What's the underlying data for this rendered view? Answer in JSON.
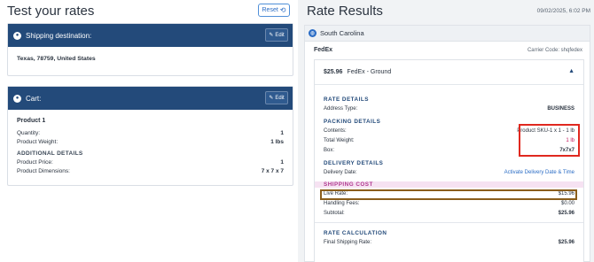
{
  "left": {
    "title": "Test your rates",
    "reset_label": "Reset",
    "shipping_card": {
      "title": "Shipping destination:",
      "edit_label": "Edit",
      "address": "Texas, 78759, United States"
    },
    "cart_card": {
      "title": "Cart:",
      "edit_label": "Edit",
      "product_name": "Product 1",
      "rows": [
        {
          "label": "Quantity:",
          "value": "1"
        },
        {
          "label": "Product Weight:",
          "value": "1 lbs"
        }
      ],
      "additional_heading": "ADDITIONAL DETAILS",
      "additional_rows": [
        {
          "label": "Product Price:",
          "value": "1"
        },
        {
          "label": "Product Dimensions:",
          "value": "7 x 7 x 7"
        }
      ]
    }
  },
  "right": {
    "title": "Rate Results",
    "timestamp": "09/02/2025, 6:02 PM",
    "state": "South Carolina",
    "carrier_name": "FedEx",
    "carrier_code": "Carrier Code: shqfedex",
    "rate_price": "$25.96",
    "rate_service": "FedEx - Ground",
    "rate_details": {
      "heading": "RATE DETAILS",
      "rows": [
        {
          "label": "Address Type:",
          "value": "BUSINESS"
        }
      ]
    },
    "packing_details": {
      "heading": "PACKING DETAILS",
      "rows": [
        {
          "label": "Contents:",
          "value": "Product SKU-1 x 1 - 1 lb"
        },
        {
          "label": "Total Weight:",
          "value": "1 lb"
        },
        {
          "label": "Box:",
          "value": "7x7x7"
        }
      ]
    },
    "delivery_details": {
      "heading": "DELIVERY DETAILS",
      "label": "Delivery Date:",
      "link": "Activate Delivery Date & Time"
    },
    "shipping_cost": {
      "heading": "SHIPPING COST",
      "rows": [
        {
          "label": "Live Rate:",
          "value": "$15.96"
        },
        {
          "label": "Handling Fees:",
          "value": "$0.00"
        },
        {
          "label": "Subtotal:",
          "value": "$25.96"
        }
      ]
    },
    "rate_calculation": {
      "heading": "RATE CALCULATION",
      "rows": [
        {
          "label": "Final Shipping Rate:",
          "value": "$25.96"
        }
      ]
    }
  },
  "colors": {
    "card_header": "#234a7a",
    "accent": "#2a6cc5",
    "highlight_red": "#e0281f",
    "highlight_gold": "#8a5d1b"
  }
}
